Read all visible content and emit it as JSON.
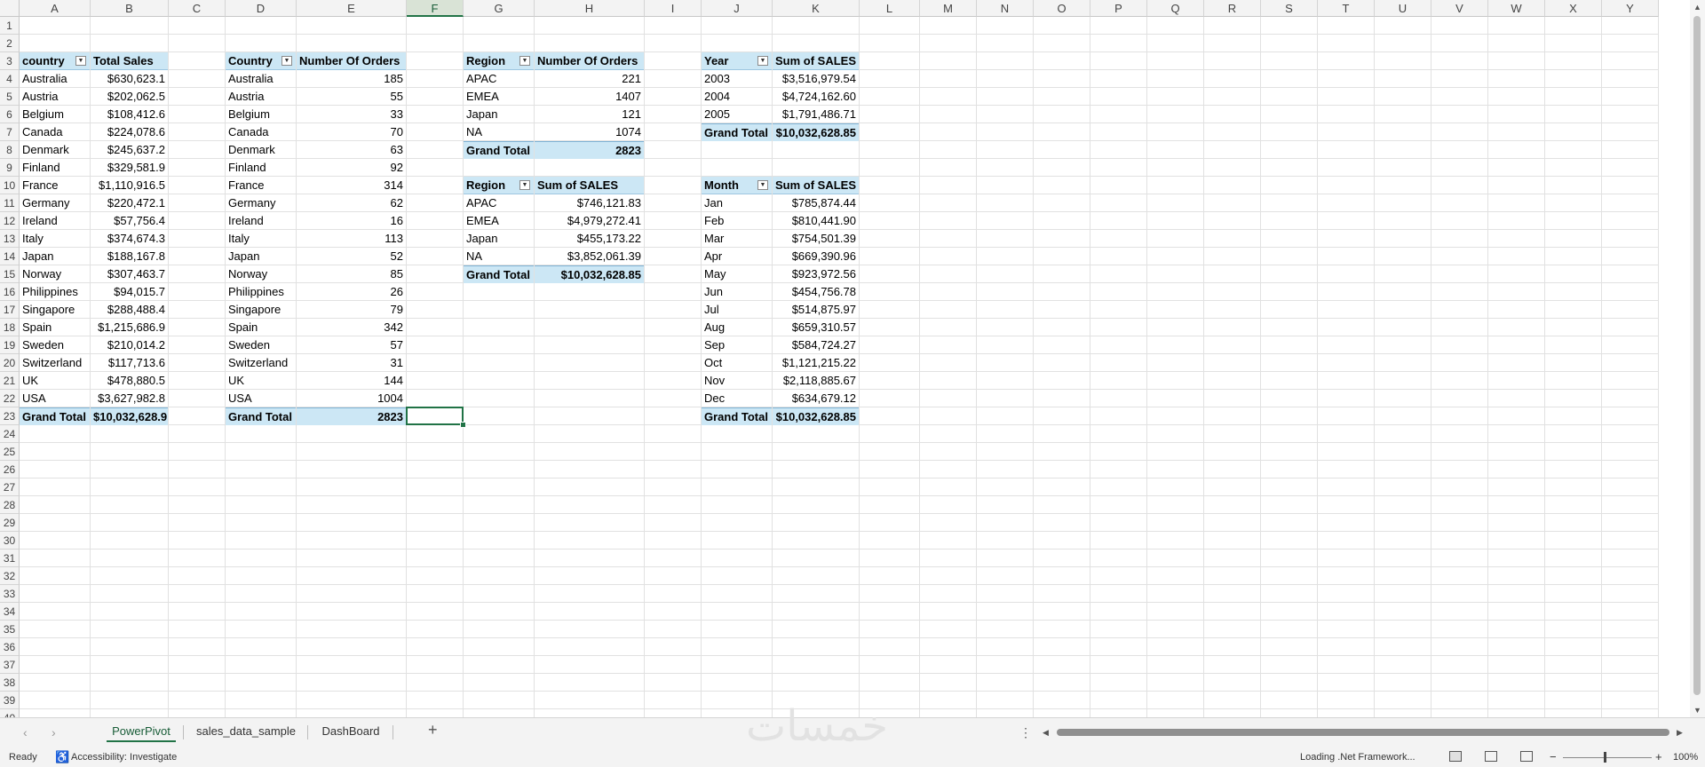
{
  "columns": [
    "A",
    "B",
    "C",
    "D",
    "E",
    "F",
    "G",
    "H",
    "I",
    "J",
    "K",
    "L",
    "M",
    "N",
    "O",
    "P",
    "Q",
    "R",
    "S",
    "T",
    "U",
    "V",
    "W",
    "X",
    "Y"
  ],
  "selected_column": "F",
  "row_count": 40,
  "tables": {
    "country_sales": {
      "headers": [
        "country",
        "Total Sales"
      ],
      "rows": [
        [
          "Australia",
          "$630,623.1"
        ],
        [
          "Austria",
          "$202,062.5"
        ],
        [
          "Belgium",
          "$108,412.6"
        ],
        [
          "Canada",
          "$224,078.6"
        ],
        [
          "Denmark",
          "$245,637.2"
        ],
        [
          "Finland",
          "$329,581.9"
        ],
        [
          "France",
          "$1,110,916.5"
        ],
        [
          "Germany",
          "$220,472.1"
        ],
        [
          "Ireland",
          "$57,756.4"
        ],
        [
          "Italy",
          "$374,674.3"
        ],
        [
          "Japan",
          "$188,167.8"
        ],
        [
          "Norway",
          "$307,463.7"
        ],
        [
          "Philippines",
          "$94,015.7"
        ],
        [
          "Singapore",
          "$288,488.4"
        ],
        [
          "Spain",
          "$1,215,686.9"
        ],
        [
          "Sweden",
          "$210,014.2"
        ],
        [
          "Switzerland",
          "$117,713.6"
        ],
        [
          "UK",
          "$478,880.5"
        ],
        [
          "USA",
          "$3,627,982.8"
        ]
      ],
      "total": [
        "Grand Total",
        "$10,032,628.9"
      ]
    },
    "country_orders": {
      "headers": [
        "Country",
        "Number Of Orders"
      ],
      "rows": [
        [
          "Australia",
          "185"
        ],
        [
          "Austria",
          "55"
        ],
        [
          "Belgium",
          "33"
        ],
        [
          "Canada",
          "70"
        ],
        [
          "Denmark",
          "63"
        ],
        [
          "Finland",
          "92"
        ],
        [
          "France",
          "314"
        ],
        [
          "Germany",
          "62"
        ],
        [
          "Ireland",
          "16"
        ],
        [
          "Italy",
          "113"
        ],
        [
          "Japan",
          "52"
        ],
        [
          "Norway",
          "85"
        ],
        [
          "Philippines",
          "26"
        ],
        [
          "Singapore",
          "79"
        ],
        [
          "Spain",
          "342"
        ],
        [
          "Sweden",
          "57"
        ],
        [
          "Switzerland",
          "31"
        ],
        [
          "UK",
          "144"
        ],
        [
          "USA",
          "1004"
        ]
      ],
      "total": [
        "Grand Total",
        "2823"
      ]
    },
    "region_orders": {
      "headers": [
        "Region",
        "Number Of Orders"
      ],
      "rows": [
        [
          "APAC",
          "221"
        ],
        [
          "EMEA",
          "1407"
        ],
        [
          "Japan",
          "121"
        ],
        [
          "NA",
          "1074"
        ]
      ],
      "total": [
        "Grand Total",
        "2823"
      ]
    },
    "region_sales": {
      "headers": [
        "Region",
        "Sum of SALES"
      ],
      "rows": [
        [
          "APAC",
          "$746,121.83"
        ],
        [
          "EMEA",
          "$4,979,272.41"
        ],
        [
          "Japan",
          "$455,173.22"
        ],
        [
          "NA",
          "$3,852,061.39"
        ]
      ],
      "total": [
        "Grand Total",
        "$10,032,628.85"
      ]
    },
    "year_sales": {
      "headers": [
        "Year",
        "Sum of SALES"
      ],
      "rows": [
        [
          "2003",
          "$3,516,979.54"
        ],
        [
          "2004",
          "$4,724,162.60"
        ],
        [
          "2005",
          "$1,791,486.71"
        ]
      ],
      "total": [
        "Grand Total",
        "$10,032,628.85"
      ]
    },
    "month_sales": {
      "headers": [
        "Month",
        "Sum of SALES"
      ],
      "rows": [
        [
          "Jan",
          "$785,874.44"
        ],
        [
          "Feb",
          "$810,441.90"
        ],
        [
          "Mar",
          "$754,501.39"
        ],
        [
          "Apr",
          "$669,390.96"
        ],
        [
          "May",
          "$923,972.56"
        ],
        [
          "Jun",
          "$454,756.78"
        ],
        [
          "Jul",
          "$514,875.97"
        ],
        [
          "Aug",
          "$659,310.57"
        ],
        [
          "Sep",
          "$584,724.27"
        ],
        [
          "Oct",
          "$1,121,215.22"
        ],
        [
          "Nov",
          "$2,118,885.67"
        ],
        [
          "Dec",
          "$634,679.12"
        ]
      ],
      "total": [
        "Grand Total",
        "$10,032,628.85"
      ]
    }
  },
  "sheet_tabs": [
    "PowerPivot",
    "sales_data_sample",
    "DashBoard"
  ],
  "active_sheet": "PowerPivot",
  "add_sheet_label": "+",
  "more_label": "⋮",
  "status": {
    "ready": "Ready",
    "accessibility": "Accessibility: Investigate",
    "loading": "Loading .Net Framework...",
    "zoom": "100%"
  },
  "watermark_text": "خمسات",
  "icons": {
    "filter": "filter-dropdown-icon",
    "accessibility": "accessibility-icon",
    "view_normal": "normal-view-icon",
    "view_layout": "page-layout-view-icon",
    "view_break": "page-break-view-icon"
  },
  "colors": {
    "pivot_header_bg": "#cce7f5",
    "selection": "#217346"
  }
}
